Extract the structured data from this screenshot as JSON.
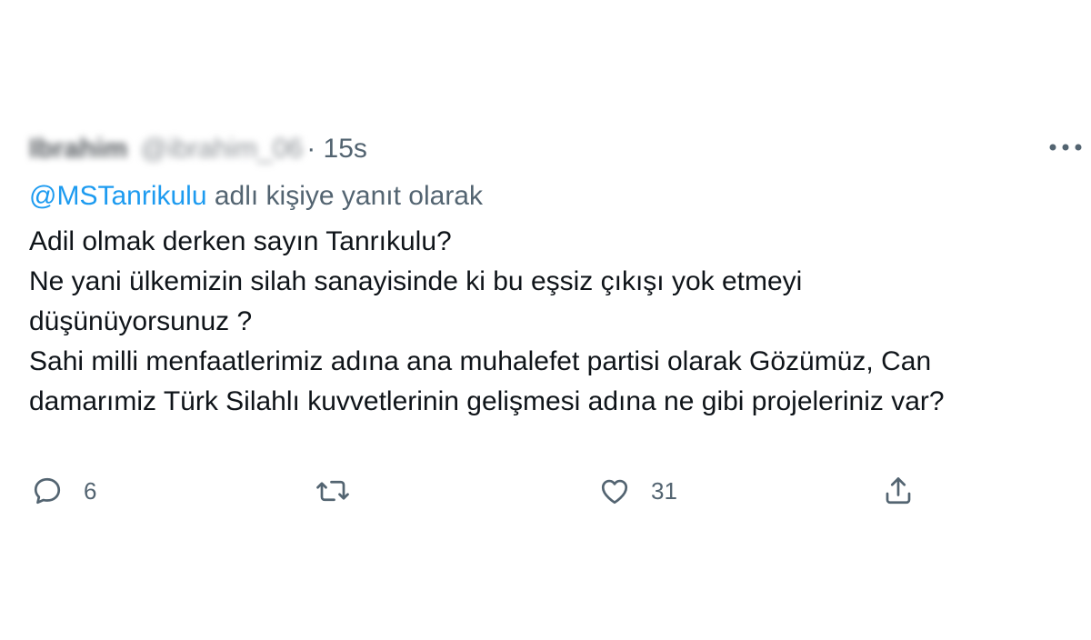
{
  "tweet": {
    "time": "· 15s",
    "reply_prefix": "@MSTanrikulu",
    "reply_suffix": " adlı kişiye yanıt olarak",
    "lines": [
      "Adil olmak derken sayın Tanrıkulu?",
      "Ne yani ülkemizin silah sanayisinde ki bu eşsiz çıkışı yok etmeyi",
      "düşünüyorsunuz ?",
      "Sahi milli menfaatlerimiz adına ana muhalefet partisi olarak Gözümüz, Can",
      "damarımiz Türk Silahlı kuvvetlerinin gelişmesi adına ne gibi projeleriniz var?"
    ]
  },
  "actions": {
    "reply_count": "6",
    "retweet_count": "",
    "like_count": "31"
  },
  "icons": {
    "more": "more-horizontal-icon",
    "reply": "reply-bubble-icon",
    "retweet": "retweet-icon",
    "like": "heart-icon",
    "share": "share-upload-icon"
  },
  "colors": {
    "text": "#0f1419",
    "secondary": "#536471",
    "link": "#1d9bf0"
  }
}
